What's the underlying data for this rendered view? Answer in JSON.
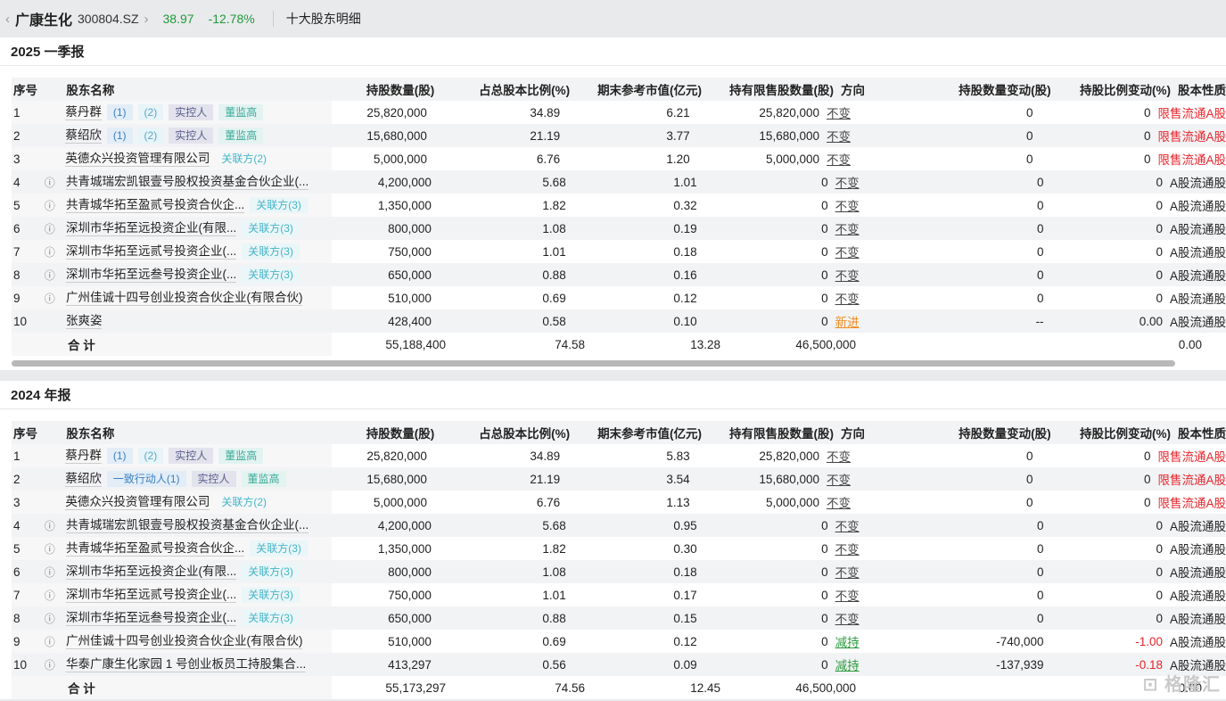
{
  "header": {
    "company": "广康生化",
    "code": "300804.SZ",
    "price": "38.97",
    "change": "-12.78%",
    "page_title": "十大股东明细"
  },
  "columns": [
    "序号",
    "股东名称",
    "持股数量(股)",
    "占总股本比例(%)",
    "期末参考市值(亿元)",
    "持有限售股数量(股)",
    "方向",
    "持股数量变动(股)",
    "持股比例变动(%)",
    "股本性质"
  ],
  "watermark": "格隆汇",
  "sections": [
    {
      "title": "2025 一季报",
      "rows": [
        {
          "no": "1",
          "name": "蔡丹群",
          "q": false,
          "tags": [
            [
              "(1)",
              "a"
            ],
            [
              "(2)",
              "b"
            ],
            [
              "实控人",
              "c"
            ],
            [
              "董监高",
              "d"
            ]
          ],
          "shares": "25,820,000",
          "pct": "34.89",
          "mv": "6.21",
          "restricted": "25,820,000",
          "dir": "不变",
          "dirtype": "",
          "chg": "0",
          "pchg": "0",
          "pchgred": false,
          "nature": "限售流通A股",
          "naturered": true
        },
        {
          "no": "2",
          "name": "蔡绍欣",
          "q": false,
          "tags": [
            [
              "(1)",
              "a"
            ],
            [
              "(2)",
              "b"
            ],
            [
              "实控人",
              "c"
            ],
            [
              "董监高",
              "d"
            ]
          ],
          "shares": "15,680,000",
          "pct": "21.19",
          "mv": "3.77",
          "restricted": "15,680,000",
          "dir": "不变",
          "dirtype": "",
          "chg": "0",
          "pchg": "0",
          "pchgred": false,
          "nature": "限售流通A股",
          "naturered": true
        },
        {
          "no": "3",
          "name": "英德众兴投资管理有限公司",
          "q": false,
          "tags": [
            [
              "关联方(2)",
              "e0"
            ]
          ],
          "shares": "5,000,000",
          "pct": "6.76",
          "mv": "1.20",
          "restricted": "5,000,000",
          "dir": "不变",
          "dirtype": "",
          "chg": "0",
          "pchg": "0",
          "pchgred": false,
          "nature": "限售流通A股",
          "naturered": true
        },
        {
          "no": "4",
          "name": "共青城瑞宏凯银壹号股权投资基金合伙企业(...",
          "q": true,
          "tags": [],
          "shares": "4,200,000",
          "pct": "5.68",
          "mv": "1.01",
          "restricted": "0",
          "dir": "不变",
          "dirtype": "",
          "chg": "0",
          "pchg": "0",
          "pchgred": false,
          "nature": "A股流通股",
          "naturered": false
        },
        {
          "no": "5",
          "name": "共青城华拓至盈贰号投资合伙企...",
          "q": true,
          "tags": [
            [
              "关联方(3)",
              "e"
            ]
          ],
          "shares": "1,350,000",
          "pct": "1.82",
          "mv": "0.32",
          "restricted": "0",
          "dir": "不变",
          "dirtype": "",
          "chg": "0",
          "pchg": "0",
          "pchgred": false,
          "nature": "A股流通股",
          "naturered": false
        },
        {
          "no": "6",
          "name": "深圳市华拓至远投资企业(有限...",
          "q": true,
          "tags": [
            [
              "关联方(3)",
              "e"
            ]
          ],
          "shares": "800,000",
          "pct": "1.08",
          "mv": "0.19",
          "restricted": "0",
          "dir": "不变",
          "dirtype": "",
          "chg": "0",
          "pchg": "0",
          "pchgred": false,
          "nature": "A股流通股",
          "naturered": false
        },
        {
          "no": "7",
          "name": "深圳市华拓至远贰号投资企业(...",
          "q": true,
          "tags": [
            [
              "关联方(3)",
              "e"
            ]
          ],
          "shares": "750,000",
          "pct": "1.01",
          "mv": "0.18",
          "restricted": "0",
          "dir": "不变",
          "dirtype": "",
          "chg": "0",
          "pchg": "0",
          "pchgred": false,
          "nature": "A股流通股",
          "naturered": false
        },
        {
          "no": "8",
          "name": "深圳市华拓至远叁号投资企业(...",
          "q": true,
          "tags": [
            [
              "关联方(3)",
              "e"
            ]
          ],
          "shares": "650,000",
          "pct": "0.88",
          "mv": "0.16",
          "restricted": "0",
          "dir": "不变",
          "dirtype": "",
          "chg": "0",
          "pchg": "0",
          "pchgred": false,
          "nature": "A股流通股",
          "naturered": false
        },
        {
          "no": "9",
          "name": "广州佳诚十四号创业投资合伙企业(有限合伙)",
          "q": true,
          "tags": [],
          "shares": "510,000",
          "pct": "0.69",
          "mv": "0.12",
          "restricted": "0",
          "dir": "不变",
          "dirtype": "",
          "chg": "0",
          "pchg": "0",
          "pchgred": false,
          "nature": "A股流通股",
          "naturered": false
        },
        {
          "no": "10",
          "name": "张爽姿",
          "q": false,
          "tags": [],
          "shares": "428,400",
          "pct": "0.58",
          "mv": "0.10",
          "restricted": "0",
          "dir": "新进",
          "dirtype": "new",
          "chg": "--",
          "pchg": "0.00",
          "pchgred": false,
          "nature": "A股流通股",
          "naturered": false
        }
      ],
      "total": {
        "label": "合 计",
        "shares": "55,188,400",
        "pct": "74.58",
        "mv": "13.28",
        "restricted": "46,500,000",
        "pchg": "0.00"
      }
    },
    {
      "title": "2024 年报",
      "rows": [
        {
          "no": "1",
          "name": "蔡丹群",
          "q": false,
          "tags": [
            [
              "(1)",
              "a"
            ],
            [
              "(2)",
              "b"
            ],
            [
              "实控人",
              "c"
            ],
            [
              "董监高",
              "d"
            ]
          ],
          "shares": "25,820,000",
          "pct": "34.89",
          "mv": "5.83",
          "restricted": "25,820,000",
          "dir": "不变",
          "dirtype": "",
          "chg": "0",
          "pchg": "0",
          "pchgred": false,
          "nature": "限售流通A股",
          "naturered": true
        },
        {
          "no": "2",
          "name": "蔡绍欣",
          "q": false,
          "tags": [
            [
              "一致行动人(1)",
              "a"
            ],
            [
              "实控人",
              "c"
            ],
            [
              "董监高",
              "d"
            ]
          ],
          "shares": "15,680,000",
          "pct": "21.19",
          "mv": "3.54",
          "restricted": "15,680,000",
          "dir": "不变",
          "dirtype": "",
          "chg": "0",
          "pchg": "0",
          "pchgred": false,
          "nature": "限售流通A股",
          "naturered": true
        },
        {
          "no": "3",
          "name": "英德众兴投资管理有限公司",
          "q": false,
          "tags": [
            [
              "关联方(2)",
              "e0"
            ]
          ],
          "shares": "5,000,000",
          "pct": "6.76",
          "mv": "1.13",
          "restricted": "5,000,000",
          "dir": "不变",
          "dirtype": "",
          "chg": "0",
          "pchg": "0",
          "pchgred": false,
          "nature": "限售流通A股",
          "naturered": true
        },
        {
          "no": "4",
          "name": "共青城瑞宏凯银壹号股权投资基金合伙企业(...",
          "q": true,
          "tags": [],
          "shares": "4,200,000",
          "pct": "5.68",
          "mv": "0.95",
          "restricted": "0",
          "dir": "不变",
          "dirtype": "",
          "chg": "0",
          "pchg": "0",
          "pchgred": false,
          "nature": "A股流通股",
          "naturered": false
        },
        {
          "no": "5",
          "name": "共青城华拓至盈贰号投资合伙企...",
          "q": true,
          "tags": [
            [
              "关联方(3)",
              "e"
            ]
          ],
          "shares": "1,350,000",
          "pct": "1.82",
          "mv": "0.30",
          "restricted": "0",
          "dir": "不变",
          "dirtype": "",
          "chg": "0",
          "pchg": "0",
          "pchgred": false,
          "nature": "A股流通股",
          "naturered": false
        },
        {
          "no": "6",
          "name": "深圳市华拓至远投资企业(有限...",
          "q": true,
          "tags": [
            [
              "关联方(3)",
              "e"
            ]
          ],
          "shares": "800,000",
          "pct": "1.08",
          "mv": "0.18",
          "restricted": "0",
          "dir": "不变",
          "dirtype": "",
          "chg": "0",
          "pchg": "0",
          "pchgred": false,
          "nature": "A股流通股",
          "naturered": false
        },
        {
          "no": "7",
          "name": "深圳市华拓至远贰号投资企业(...",
          "q": true,
          "tags": [
            [
              "关联方(3)",
              "e"
            ]
          ],
          "shares": "750,000",
          "pct": "1.01",
          "mv": "0.17",
          "restricted": "0",
          "dir": "不变",
          "dirtype": "",
          "chg": "0",
          "pchg": "0",
          "pchgred": false,
          "nature": "A股流通股",
          "naturered": false
        },
        {
          "no": "8",
          "name": "深圳市华拓至远叁号投资企业(...",
          "q": true,
          "tags": [
            [
              "关联方(3)",
              "e"
            ]
          ],
          "shares": "650,000",
          "pct": "0.88",
          "mv": "0.15",
          "restricted": "0",
          "dir": "不变",
          "dirtype": "",
          "chg": "0",
          "pchg": "0",
          "pchgred": false,
          "nature": "A股流通股",
          "naturered": false
        },
        {
          "no": "9",
          "name": "广州佳诚十四号创业投资合伙企业(有限合伙)",
          "q": true,
          "tags": [],
          "shares": "510,000",
          "pct": "0.69",
          "mv": "0.12",
          "restricted": "0",
          "dir": "减持",
          "dirtype": "down",
          "chg": "-740,000",
          "pchg": "-1.00",
          "pchgred": true,
          "nature": "A股流通股",
          "naturered": false
        },
        {
          "no": "10",
          "name": "华泰广康生化家园 1 号创业板员工持股集合...",
          "q": true,
          "tags": [],
          "shares": "413,297",
          "pct": "0.56",
          "mv": "0.09",
          "restricted": "0",
          "dir": "减持",
          "dirtype": "down",
          "chg": "-137,939",
          "pchg": "-0.18",
          "pchgred": true,
          "nature": "A股流通股",
          "naturered": false
        }
      ],
      "total": {
        "label": "合 计",
        "shares": "55,173,297",
        "pct": "74.56",
        "mv": "12.45",
        "restricted": "46,500,000",
        "pchg": "0.00"
      }
    }
  ]
}
